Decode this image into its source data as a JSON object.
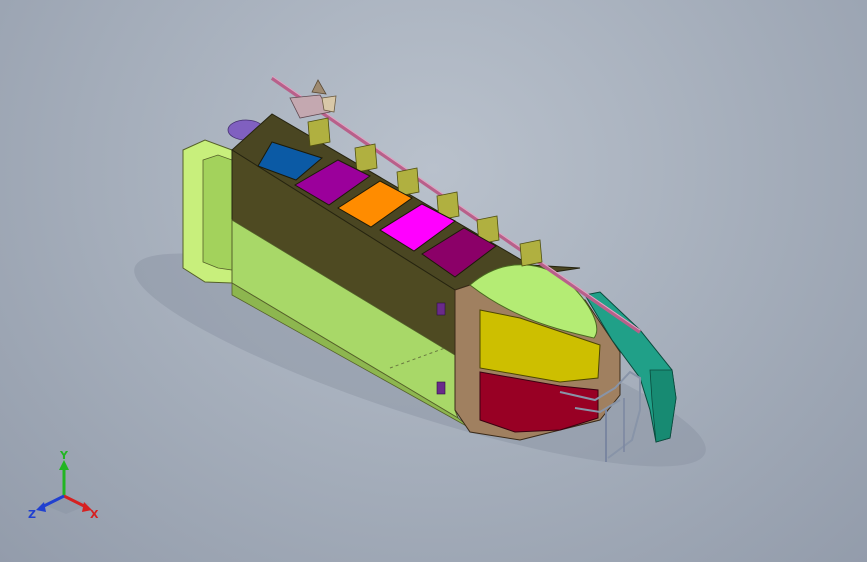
{
  "viewport": {
    "background_top": "#b9c1cc",
    "background_bottom": "#939cab"
  },
  "triad": {
    "x_label": "X",
    "y_label": "Y",
    "z_label": "Z",
    "x_color": "#d62020",
    "y_color": "#22b522",
    "z_color": "#2040d0"
  },
  "model": {
    "panel_colors": [
      "#0b5aa5",
      "#9b009b",
      "#ff8c00",
      "#ff00ff",
      "#8b0068"
    ],
    "hull_dark": "#4a4622",
    "hull_light": "#a8d868",
    "nose_top": "#b4ec74",
    "front_upper": "#cdbf00",
    "front_lower": "#980024",
    "rail_color": "#20a088",
    "pipe_color": "#b8608a"
  }
}
